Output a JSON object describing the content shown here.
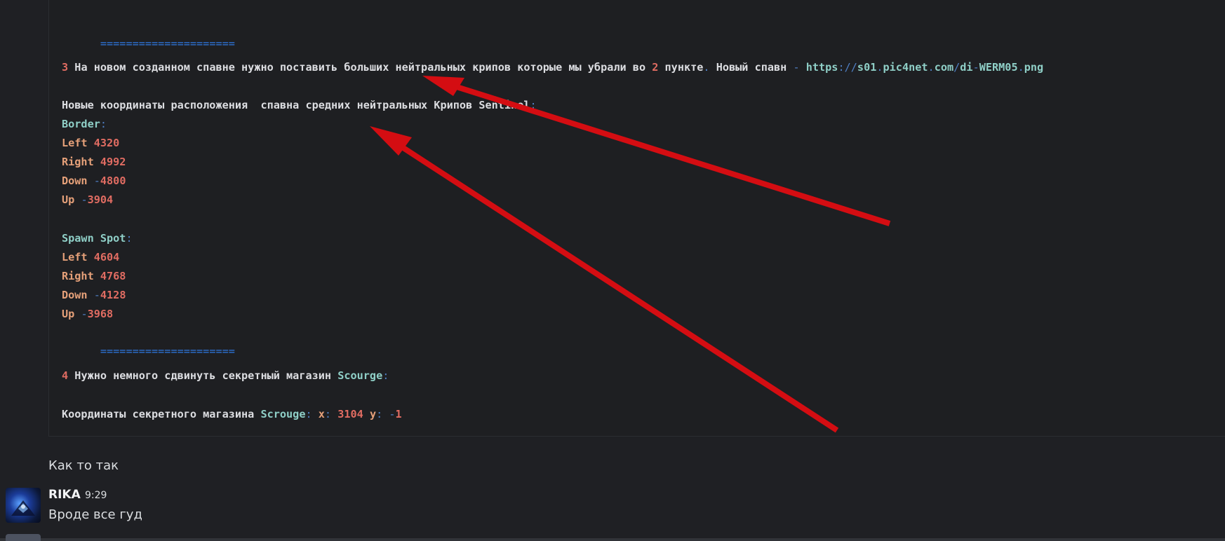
{
  "code": {
    "separator_top": "=====================",
    "item3": {
      "num": "3",
      "text1": " На новом созданном спавне нужно поставить больших нейтральных крипов которые мы убрали во ",
      "num2": "2",
      "text2": " пункте",
      "dot": ".",
      "text3": " Новый спавн ",
      "dash": "-",
      "link_a": " https",
      "colon": ":",
      "slashes": "//",
      "link_b": "s01",
      "dot2": ".",
      "link_c": "pic4net",
      "dot3": ".",
      "link_d": "com",
      "slash": "/",
      "link_e": "di",
      "dash2": "-",
      "link_f": "WERM05",
      "dot4": ".",
      "link_g": "png"
    },
    "coords_title": "Новые координаты расположения  спавна средних нейтральных Крипов Sentinel",
    "coords_title_colon": ":",
    "border": {
      "label": "Border",
      "colon": ":",
      "left_key": "Left",
      "left_val": "4320",
      "right_key": "Right",
      "right_val": "4992",
      "down_key": "Down",
      "down_minus": "-",
      "down_val": "4800",
      "up_key": "Up",
      "up_minus": "-",
      "up_val": "3904"
    },
    "spawn": {
      "label": "Spawn Spot",
      "colon": ":",
      "left_key": "Left",
      "left_val": "4604",
      "right_key": "Right",
      "right_val": "4768",
      "down_key": "Down",
      "down_minus": "-",
      "down_val": "4128",
      "up_key": "Up",
      "up_minus": "-",
      "up_val": "3968"
    },
    "separator_bottom": "=====================",
    "item4": {
      "num": "4",
      "text": " Нужно немного сдвинуть секретный магазин ",
      "name": "Scourge",
      "colon": ":"
    },
    "shop": {
      "text": "Координаты секретного магазина ",
      "name": "Scrouge",
      "colon1": ":",
      "x_label": " x",
      "colon2": ":",
      "x_val": " 3104",
      "y_label": " y",
      "colon3": ":",
      "y_minus": " -",
      "y_val": "1"
    }
  },
  "messages": [
    {
      "text": "Как то так"
    },
    {
      "author": "RIKA",
      "time": "9:29",
      "text": "Вроде все гуд"
    }
  ],
  "colors": {
    "arrow": "#d40d12",
    "separator": "#2f7ae5",
    "number": "#e06c62",
    "key": "#e5a079",
    "name": "#8fcfc7"
  }
}
